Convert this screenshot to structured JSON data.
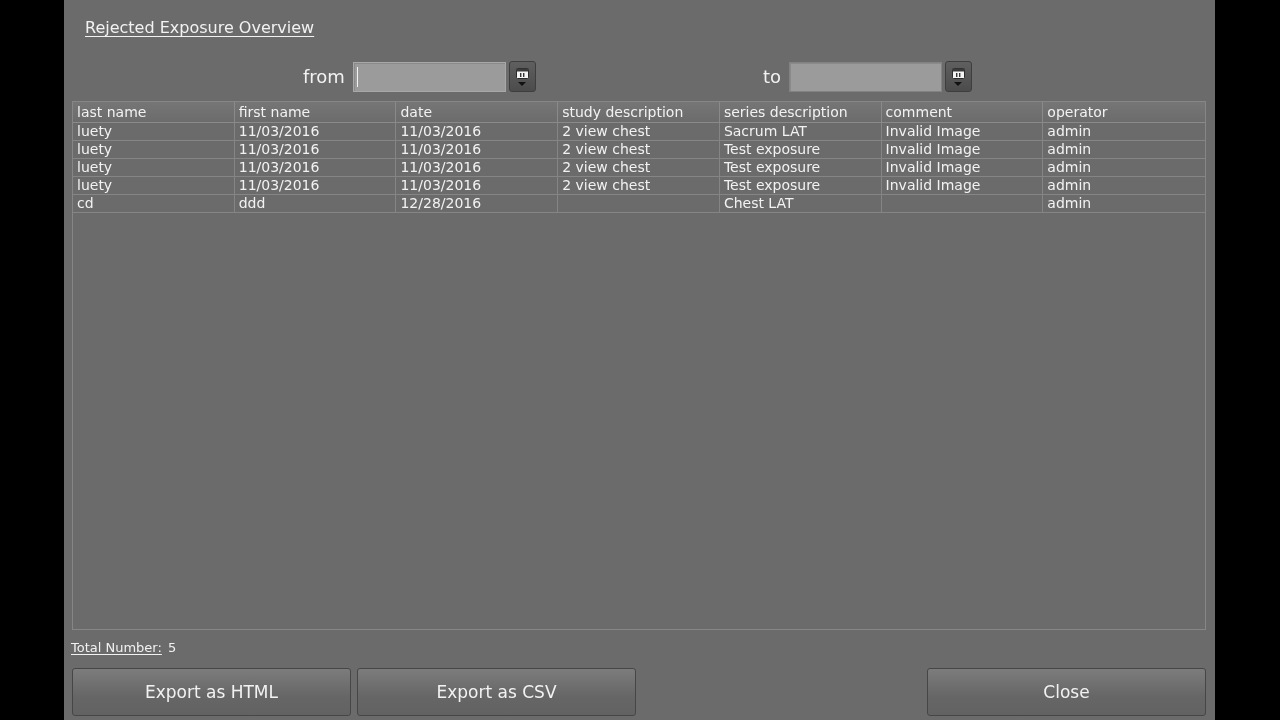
{
  "window": {
    "title": "Rejected Exposure Overview"
  },
  "filters": [
    {
      "label": "from",
      "focused": true
    },
    {
      "label": "to",
      "focused": false
    }
  ],
  "table": {
    "columns": [
      "last name",
      "first name",
      "date",
      "study description",
      "series description",
      "comment",
      "operator"
    ],
    "rows": [
      [
        "luety",
        "11/03/2016",
        "11/03/2016",
        "2 view chest",
        "Sacrum LAT",
        "Invalid Image",
        "admin"
      ],
      [
        "luety",
        "11/03/2016",
        "11/03/2016",
        "2 view chest",
        "Test exposure",
        "Invalid Image",
        "admin"
      ],
      [
        "luety",
        "11/03/2016",
        "11/03/2016",
        "2 view chest",
        "Test exposure",
        "Invalid Image",
        "admin"
      ],
      [
        "luety",
        "11/03/2016",
        "11/03/2016",
        "2 view chest",
        "Test exposure",
        "Invalid Image",
        "admin"
      ],
      [
        "cd",
        "ddd",
        "12/28/2016",
        null,
        "Chest LAT",
        null,
        "admin"
      ]
    ]
  },
  "total": {
    "label": "Total Number:",
    "value": "5"
  },
  "export_buttons": [
    "Export as HTML",
    "Export as CSV"
  ],
  "close_button": "Close"
}
